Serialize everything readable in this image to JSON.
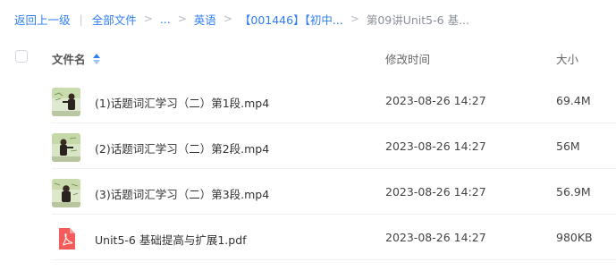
{
  "breadcrumb": {
    "back": "返回上一级",
    "separator": "|",
    "root": "全部文件",
    "chevron": ">",
    "ellipsis": "...",
    "level1": "英语",
    "level2": "【001446】【初中...",
    "current": "第09讲Unit5-6 基..."
  },
  "table": {
    "columns": {
      "name": "文件名",
      "time": "修改时间",
      "size": "大小"
    },
    "rows": [
      {
        "name": "(1)话题词汇学习（二）第1段.mp4",
        "time": "2023-08-26 14:27",
        "size": "69.4M",
        "icon": "video-thumbnail-icon"
      },
      {
        "name": "(2)话题词汇学习（二）第2段.mp4",
        "time": "2023-08-26 14:27",
        "size": "56M",
        "icon": "video-thumbnail-icon"
      },
      {
        "name": "(3)话题词汇学习（二）第3段.mp4",
        "time": "2023-08-26 14:27",
        "size": "56.9M",
        "icon": "video-thumbnail-icon"
      },
      {
        "name": "Unit5-6 基础提高与扩展1.pdf",
        "time": "2023-08-26 14:27",
        "size": "980KB",
        "icon": "pdf-icon"
      }
    ]
  },
  "colors": {
    "accent": "#2f7ef6",
    "pdf": "#f45b5b"
  }
}
